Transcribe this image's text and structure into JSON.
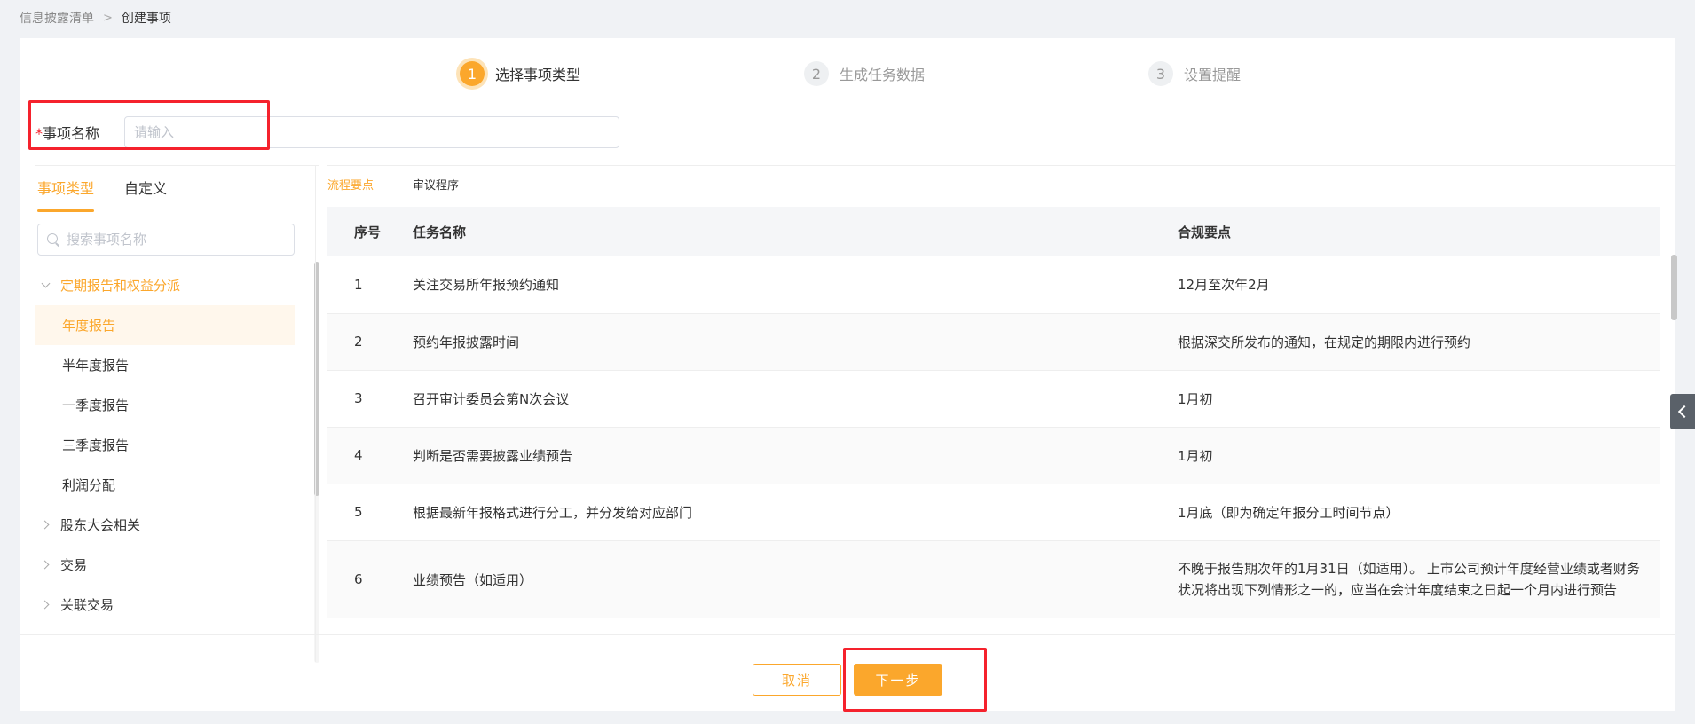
{
  "breadcrumb": {
    "parent": "信息披露清单",
    "separator": ">",
    "current": "创建事项"
  },
  "steps": [
    {
      "number": "1",
      "label": "选择事项类型",
      "active": true
    },
    {
      "number": "2",
      "label": "生成任务数据",
      "active": false
    },
    {
      "number": "3",
      "label": "设置提醒",
      "active": false
    }
  ],
  "name_field": {
    "required_mark": "*",
    "label": "事项名称",
    "value": "",
    "placeholder": "请输入"
  },
  "left_tabs": [
    {
      "label": "事项类型",
      "active": true
    },
    {
      "label": "自定义",
      "active": false
    }
  ],
  "search": {
    "placeholder": "搜索事项名称"
  },
  "tree": {
    "group_expanded": "定期报告和权益分派",
    "children": [
      "年度报告",
      "半年度报告",
      "一季度报告",
      "三季度报告",
      "利润分配"
    ],
    "selected_child": "年度报告",
    "groups_collapsed": [
      "股东大会相关",
      "交易",
      "关联交易"
    ]
  },
  "right_tabs": [
    {
      "label": "流程要点",
      "active": true
    },
    {
      "label": "审议程序",
      "active": false
    }
  ],
  "table": {
    "headers": [
      "序号",
      "任务名称",
      "合规要点"
    ],
    "rows": [
      {
        "no": "1",
        "task": "关注交易所年报预约通知",
        "rule": "12月至次年2月"
      },
      {
        "no": "2",
        "task": "预约年报披露时间",
        "rule": "根据深交所发布的通知，在规定的期限内进行预约"
      },
      {
        "no": "3",
        "task": "召开审计委员会第N次会议",
        "rule": "1月初"
      },
      {
        "no": "4",
        "task": "判断是否需要披露业绩预告",
        "rule": "1月初"
      },
      {
        "no": "5",
        "task": "根据最新年报格式进行分工，并分发给对应部门",
        "rule": "1月底（即为确定年报分工时间节点）"
      },
      {
        "no": "6",
        "task": "业绩预告（如适用）",
        "rule": "不晚于报告期次年的1月31日（如适用）。 上市公司预计年度经营业绩或者财务状况将出现下列情形之一的，应当在会计年度结束之日起一个月内进行预告"
      }
    ]
  },
  "footer": {
    "cancel_label": "取消",
    "next_label": "下一步"
  },
  "colors": {
    "accent": "#fba72c",
    "highlight_box": "#f5222d"
  },
  "icons": {
    "breadcrumb_separator": "chevron-right-icon",
    "search": "search-icon",
    "side_handle": "chevron-left-icon"
  }
}
